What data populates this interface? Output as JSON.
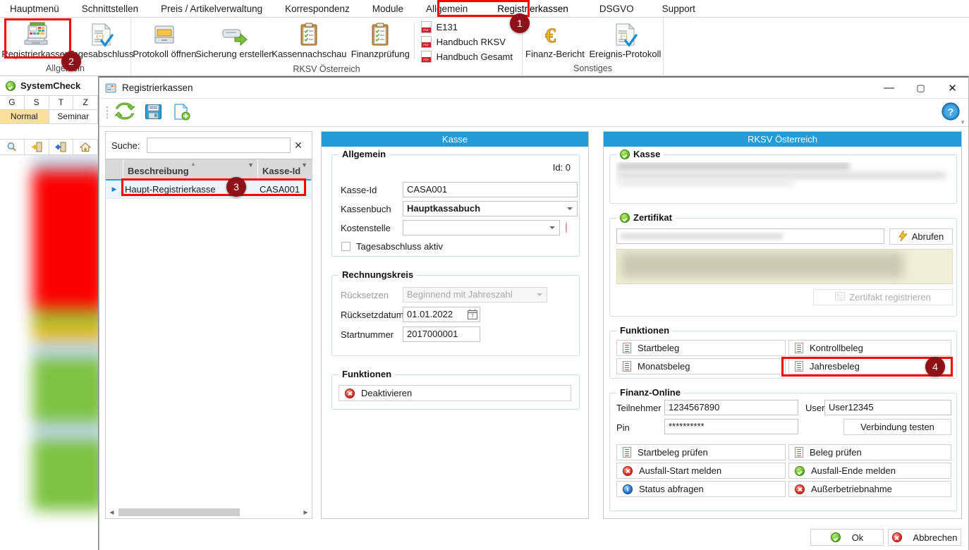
{
  "ribbon": {
    "tabs": [
      {
        "label": "Hauptmenü"
      },
      {
        "label": "Schnittstellen"
      },
      {
        "label": "Preis / Artikelverwaltung"
      },
      {
        "label": "Korrespondenz"
      },
      {
        "label": "Module"
      },
      {
        "label": "Allgemein"
      },
      {
        "label": "Registrierkassen"
      },
      {
        "label": "DSGVO"
      },
      {
        "label": "Support"
      }
    ],
    "groups": [
      {
        "label": "Allgemein",
        "buttons": [
          {
            "label": "Registrierkassen",
            "icon": "cash-register-icon"
          },
          {
            "label": "Tagesabschluss",
            "icon": "document-check-icon"
          }
        ]
      },
      {
        "label": "RKSV Österreich",
        "buttons": [
          {
            "label": "Protokoll öffnen",
            "icon": "archive-open-icon"
          },
          {
            "label": "Sicherung erstellen",
            "icon": "backup-arrow-icon"
          },
          {
            "label": "Kassennachschau",
            "icon": "clipboard-check-icon"
          },
          {
            "label": "Finanzprüfung",
            "icon": "clipboard-check-icon"
          }
        ],
        "links": [
          {
            "label": "E131",
            "icon": "pdf-icon"
          },
          {
            "label": "Handbuch RKSV",
            "icon": "pdf-icon"
          },
          {
            "label": "Handbuch Gesamt",
            "icon": "pdf-icon"
          }
        ]
      },
      {
        "label": "Sonstiges",
        "buttons": [
          {
            "label": "Finanz-Bericht",
            "icon": "euro-icon"
          },
          {
            "label": "Ereignis-Protokoll",
            "icon": "document-check-icon"
          }
        ]
      }
    ]
  },
  "systemcheck": {
    "title": "SystemCheck",
    "status_icon": "check-circle-icon",
    "letters": [
      "G",
      "S",
      "T",
      "Z"
    ],
    "modes": [
      {
        "label": "Normal",
        "selected": true
      },
      {
        "label": "Seminar",
        "selected": false
      }
    ],
    "tool_icons": [
      "magnifier-icon",
      "login-door-icon",
      "logout-door-icon",
      "home-icon"
    ]
  },
  "child_window": {
    "title": "Registrierkassen",
    "title_icon": "cash-register-small-icon",
    "window_buttons": [
      {
        "name": "minimize",
        "glyph": "—"
      },
      {
        "name": "maximize",
        "glyph": "▢"
      },
      {
        "name": "close",
        "glyph": "✕"
      }
    ],
    "toolbar": [
      {
        "name": "refresh-button",
        "icon": "refresh-arrows-icon"
      },
      {
        "name": "save-button",
        "icon": "floppy-disk-icon"
      },
      {
        "name": "new-button",
        "icon": "new-document-icon"
      }
    ],
    "help_icon": "help-question-icon"
  },
  "grid": {
    "search_label": "Suche:",
    "search_value": "",
    "search_placeholder": "",
    "clear_glyph": "✕",
    "columns": [
      {
        "label": "Beschreibung",
        "sorted": true
      },
      {
        "label": "Kasse-Id",
        "sorted": false
      }
    ],
    "rows": [
      {
        "beschreibung": "Haupt-Registrierkasse",
        "kasse_id": "CASA001",
        "selected": true
      }
    ]
  },
  "kasse_panel": {
    "header": "Kasse",
    "allgemein": {
      "caption": "Allgemein",
      "id_label": "Id: 0",
      "fields": [
        {
          "label": "Kasse-Id",
          "value": "CASA001",
          "type": "text"
        },
        {
          "label": "Kassenbuch",
          "value": "Hauptkassabuch",
          "type": "combo"
        },
        {
          "label": "Kostenstelle",
          "value": "",
          "type": "combo-clear"
        }
      ],
      "checkbox": {
        "label": "Tagesabschluss aktiv",
        "checked": false
      }
    },
    "rechnungskreis": {
      "caption": "Rechnungskreis",
      "fields": [
        {
          "label": "Rücksetzen",
          "value": "Beginnend mit Jahreszahl",
          "type": "combo-disabled"
        },
        {
          "label": "Rücksetzdatum",
          "value": "01.01.2022",
          "type": "date"
        },
        {
          "label": "Startnummer",
          "value": "2017000001",
          "type": "text"
        }
      ]
    },
    "funktionen": {
      "caption": "Funktionen",
      "buttons": [
        {
          "label": "Deaktivieren",
          "icon": "error-circle-icon"
        }
      ]
    }
  },
  "rksv_panel": {
    "header": "RKSV Österreich",
    "kasse": {
      "caption": "Kasse",
      "status_icon": "check-circle-icon"
    },
    "zertifikat": {
      "caption": "Zertifikat",
      "status_icon": "check-circle-icon",
      "value": "",
      "fetch_button": {
        "label": "Abrufen",
        "icon": "lightning-icon"
      },
      "register_button": {
        "label": "Zertifakt registrieren",
        "icon": "card-icon",
        "disabled": true
      }
    },
    "funktionen": {
      "caption": "Funktionen",
      "buttons": [
        {
          "label": "Startbeleg",
          "icon": "document-icon"
        },
        {
          "label": "Kontrollbeleg",
          "icon": "document-icon"
        },
        {
          "label": "Monatsbeleg",
          "icon": "document-icon"
        },
        {
          "label": "Jahresbeleg",
          "icon": "document-icon"
        }
      ]
    },
    "finanz_online": {
      "caption": "Finanz-Online",
      "fields": [
        {
          "label": "Teilnehmer",
          "value": "1234567890"
        },
        {
          "label": "User",
          "value": "User12345"
        },
        {
          "label": "Pin",
          "value": "**********"
        }
      ],
      "test_button": {
        "label": "Verbindung testen"
      },
      "buttons": [
        {
          "label": "Startbeleg prüfen",
          "icon": "document-icon"
        },
        {
          "label": "Beleg prüfen",
          "icon": "document-icon"
        },
        {
          "label": "Ausfall-Start melden",
          "icon": "error-circle-icon"
        },
        {
          "label": "Ausfall-Ende melden",
          "icon": "check-circle-icon"
        },
        {
          "label": "Status abfragen",
          "icon": "info-circle-icon"
        },
        {
          "label": "Außerbetriebnahme",
          "icon": "error-circle-icon"
        }
      ]
    }
  },
  "footer": {
    "ok": {
      "label": "Ok",
      "icon": "check-circle-icon"
    },
    "cancel": {
      "label": "Abbrechen",
      "icon": "error-circle-icon"
    }
  },
  "annotations": {
    "highlight_color": "#ff0000",
    "badge_color": "#8e1118",
    "badges": [
      {
        "number": "1",
        "target": "ribbon-tab-registrierkassen"
      },
      {
        "number": "2",
        "target": "ribbon-button-registrierkassen"
      },
      {
        "number": "3",
        "target": "grid-row-haupt-registrierkasse"
      },
      {
        "number": "4",
        "target": "jahresbeleg-button"
      }
    ]
  }
}
